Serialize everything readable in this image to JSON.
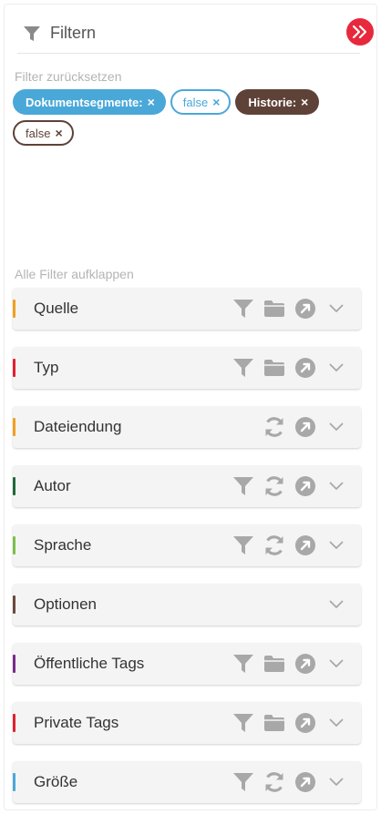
{
  "header": {
    "title": "Filtern"
  },
  "links": {
    "reset": "Filter zurücksetzen",
    "expand_all": "Alle Filter aufklappen"
  },
  "active_filters": [
    {
      "key": "Dokumentsegmente:",
      "value": "false",
      "color": "#4aa8d8"
    },
    {
      "key": "Historie:",
      "value": "false",
      "color": "#5e4238"
    }
  ],
  "chip_close_glyph": "×",
  "sections": [
    {
      "label": "Quelle",
      "color": "#f0a020",
      "icons": [
        "filter-icon",
        "folder-icon",
        "open-external-icon",
        "chevron-down-icon"
      ]
    },
    {
      "label": "Typ",
      "color": "#e02030",
      "icons": [
        "filter-icon",
        "folder-icon",
        "open-external-icon",
        "chevron-down-icon"
      ]
    },
    {
      "label": "Dateiendung",
      "color": "#f0a020",
      "icons": [
        "refresh-icon",
        "open-external-icon",
        "chevron-down-icon"
      ]
    },
    {
      "label": "Autor",
      "color": "#1e6a3a",
      "icons": [
        "filter-icon",
        "refresh-icon",
        "open-external-icon",
        "chevron-down-icon"
      ]
    },
    {
      "label": "Sprache",
      "color": "#7cc04a",
      "icons": [
        "filter-icon",
        "refresh-icon",
        "open-external-icon",
        "chevron-down-icon"
      ]
    },
    {
      "label": "Optionen",
      "color": "#6a4a3c",
      "icons": [
        "chevron-down-icon"
      ]
    },
    {
      "label": "Öffentliche Tags",
      "color": "#7a2a8a",
      "icons": [
        "filter-icon",
        "folder-icon",
        "open-external-icon",
        "chevron-down-icon"
      ]
    },
    {
      "label": "Private Tags",
      "color": "#e02030",
      "icons": [
        "filter-icon",
        "folder-icon",
        "open-external-icon",
        "chevron-down-icon"
      ]
    },
    {
      "label": "Größe",
      "color": "#4aa8d8",
      "icons": [
        "filter-icon",
        "refresh-icon",
        "open-external-icon",
        "chevron-down-icon"
      ]
    }
  ],
  "colors": {
    "accent_red": "#e8283c",
    "icon_gray": "#a8a8a8"
  }
}
